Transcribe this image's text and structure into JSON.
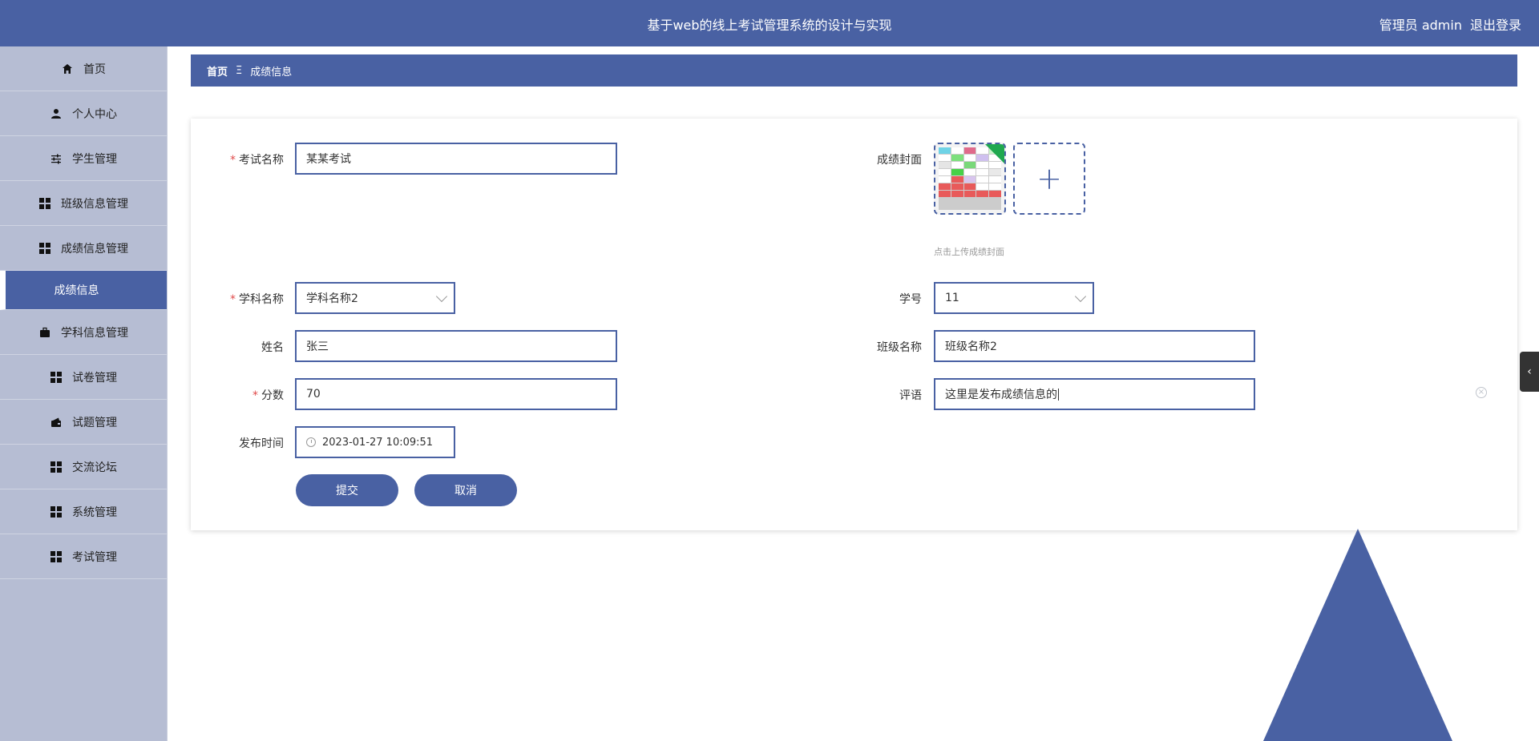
{
  "header": {
    "title": "基于web的线上考试管理系统的设计与实现",
    "user": "管理员 admin",
    "logout": "退出登录"
  },
  "sidebar": {
    "items": [
      {
        "label": "首页",
        "icon": "home-icon"
      },
      {
        "label": "个人中心",
        "icon": "user-icon"
      },
      {
        "label": "学生管理",
        "icon": "sliders-icon"
      },
      {
        "label": "班级信息管理",
        "icon": "grid-icon"
      },
      {
        "label": "成绩信息管理",
        "icon": "grid-icon"
      },
      {
        "label": "成绩信息",
        "icon": ""
      },
      {
        "label": "学科信息管理",
        "icon": "briefcase-icon"
      },
      {
        "label": "试卷管理",
        "icon": "grid-icon"
      },
      {
        "label": "试题管理",
        "icon": "wallet-icon"
      },
      {
        "label": "交流论坛",
        "icon": "grid-icon"
      },
      {
        "label": "系统管理",
        "icon": "grid-icon"
      },
      {
        "label": "考试管理",
        "icon": "grid-icon"
      }
    ]
  },
  "breadcrumb": {
    "home": "首页",
    "separator": "Ξ",
    "current": "成绩信息"
  },
  "form": {
    "exam_name": {
      "label": "考试名称",
      "value": "某某考试",
      "required": true
    },
    "cover": {
      "label": "成绩封面",
      "hint": "点击上传成绩封面",
      "plus": "+"
    },
    "subject": {
      "label": "学科名称",
      "value": "学科名称2",
      "required": true
    },
    "student_no": {
      "label": "学号",
      "value": "11"
    },
    "name": {
      "label": "姓名",
      "value": "张三"
    },
    "class_name": {
      "label": "班级名称",
      "value": "班级名称2"
    },
    "score": {
      "label": "分数",
      "value": "70",
      "required": true
    },
    "comment": {
      "label": "评语",
      "value": "这里是发布成绩信息的"
    },
    "publish_time": {
      "label": "发布时间",
      "value": "2023-01-27 10:09:51"
    },
    "submit": "提交",
    "cancel": "取消"
  },
  "colors": {
    "primary": "#4961a3",
    "sidebar_bg": "#b6bdd3",
    "required": "#e04b4b"
  }
}
